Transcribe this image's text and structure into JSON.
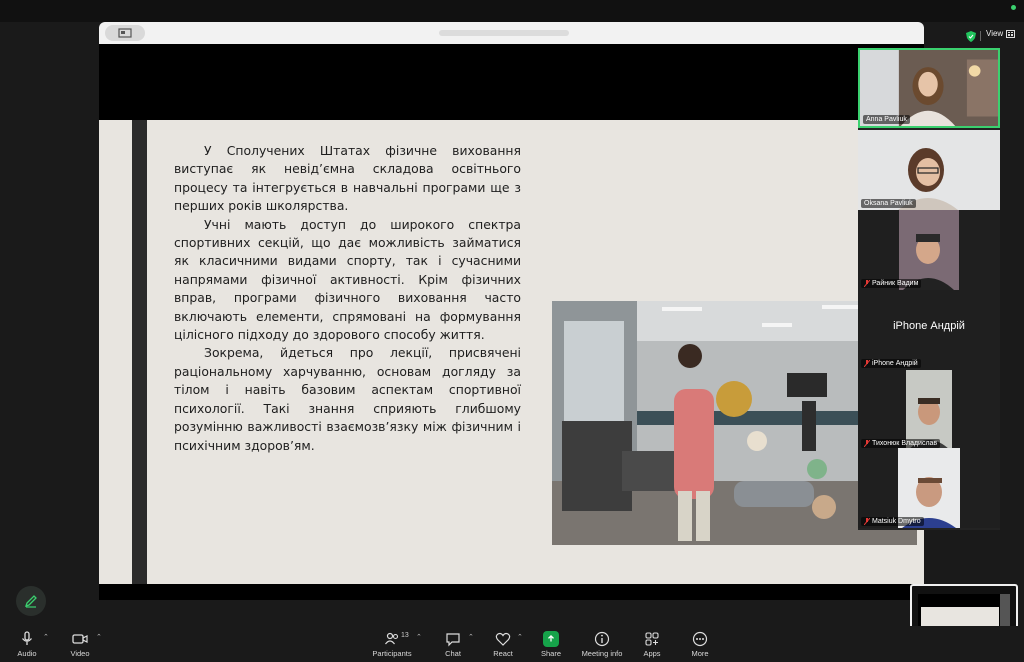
{
  "slide": {
    "paragraphs": [
      "У Сполучених Штатах фізичне виховання виступає як невід’ємна складова освітнього процесу та інтегрується в навчальні програми ще з перших років школярства.",
      "Учні мають доступ до широкого спектра спортивних секцій, що дає можливість займатися як класичними видами спорту, так і сучасними напрямами фізичної активності. Крім фізичних вправ, програми фізичного виховання часто включають елементи, спрямовані на формування цілісного підходу до здорового способу життя.",
      "Зокрема, йдеться про лекції, присвячені раціональному харчуванню, основам догляду за тілом і навіть базовим аспектам спортивної психології. Такі знання сприяють глибшому розумінню важливості взаємозв’язку між фізичним і психічним здоров’ям."
    ]
  },
  "header": {
    "view_label": "View"
  },
  "participants": [
    {
      "name": "Anna Pavliuk",
      "muted": false,
      "active": true
    },
    {
      "name": "Oksana Pavliuk",
      "muted": false,
      "active": false
    },
    {
      "name": "Райник Вадим",
      "muted": true,
      "active": false
    },
    {
      "name": "iPhone Андрій",
      "muted": true,
      "active": false,
      "center_label": "iPhone Андрій"
    },
    {
      "name": "Тихонюк Владислав",
      "muted": true,
      "active": false
    },
    {
      "name": "Matsiuk Dmytro",
      "muted": true,
      "active": false
    }
  ],
  "toolbar": {
    "audio": "Audio",
    "video": "Video",
    "participants": "Participants",
    "participants_count": "13",
    "chat": "Chat",
    "react": "React",
    "share": "Share",
    "meeting_info": "Meeting info",
    "apps": "Apps",
    "more": "More"
  },
  "colors": {
    "active_border": "#3bd16f",
    "share_green": "#16a34a",
    "slide_bg": "#e8e5e0"
  },
  "icons": [
    "mic-icon",
    "camera-icon",
    "participants-icon",
    "chat-icon",
    "react-icon",
    "share-icon",
    "info-icon",
    "apps-icon",
    "more-icon",
    "shield-icon",
    "grid-icon",
    "pencil-icon"
  ]
}
